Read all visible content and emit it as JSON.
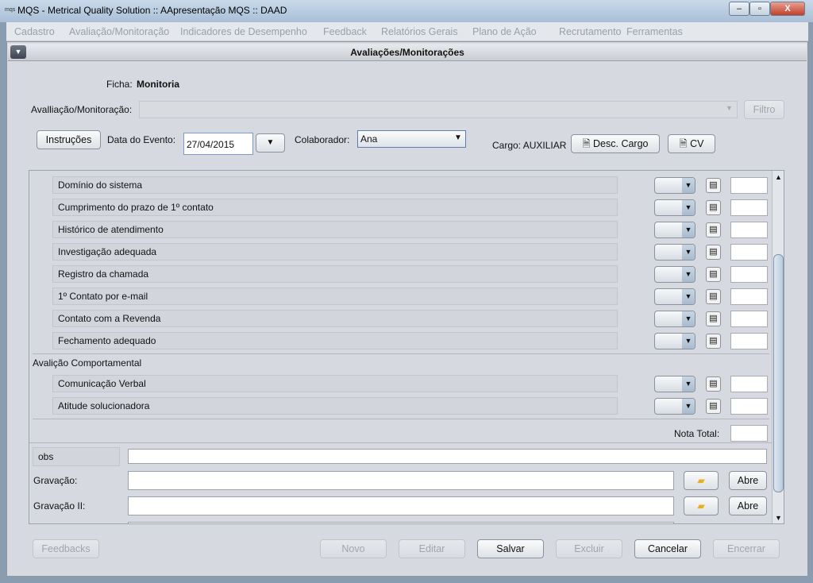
{
  "window": {
    "title": "MQS - Metrical Quality Solution :: AApresentação MQS :: DAAD",
    "app_icon": "mqs",
    "minimize": "‒",
    "maximize": "▫",
    "close": "X"
  },
  "menu": [
    "Cadastro",
    "Avaliação/Monitoração",
    "Indicadores de Desempenho",
    "Feedback",
    "Relatórios Gerais",
    "Plano de Ação",
    "Recrutamento",
    "Ferramentas"
  ],
  "frame": {
    "title": "Avaliações/Monitorações"
  },
  "form": {
    "ficha_label": "Ficha:",
    "ficha_value": "Monitoria",
    "avaliacao_label": "Avalliação/Monitoração:",
    "avaliacao_value": "",
    "filtro": "Filtro",
    "instrucoes": "Instruções",
    "data_label": "Data do Evento:",
    "data_value": "27/04/2015",
    "colaborador_label": "Colaborador:",
    "colaborador_value": "Ana",
    "cargo": "Cargo: AUXILIAR",
    "desc_cargo": "Desc. Cargo",
    "cv": "CV"
  },
  "criteria": [
    "Domínio do sistema",
    "Cumprimento do prazo de 1º contato",
    "Histórico de atendimento",
    "Investigação adequada",
    "Registro da chamada",
    "1º Contato por e-mail",
    "Contato com a Revenda",
    "Fechamento adequado"
  ],
  "section2": {
    "title": "Avalição Comportamental",
    "criteria": [
      "Comunicação Verbal",
      "Atitude solucionadora"
    ]
  },
  "nota_total_label": "Nota Total:",
  "obs_label": "obs",
  "gravacao_label": "Gravação:",
  "gravacao2_label": "Gravação II:",
  "abre": "Abre",
  "footer": {
    "feedbacks": "Feedbacks",
    "novo": "Novo",
    "editar": "Editar",
    "salvar": "Salvar",
    "excluir": "Excluir",
    "cancelar": "Cancelar",
    "encerrar": "Encerrar"
  }
}
